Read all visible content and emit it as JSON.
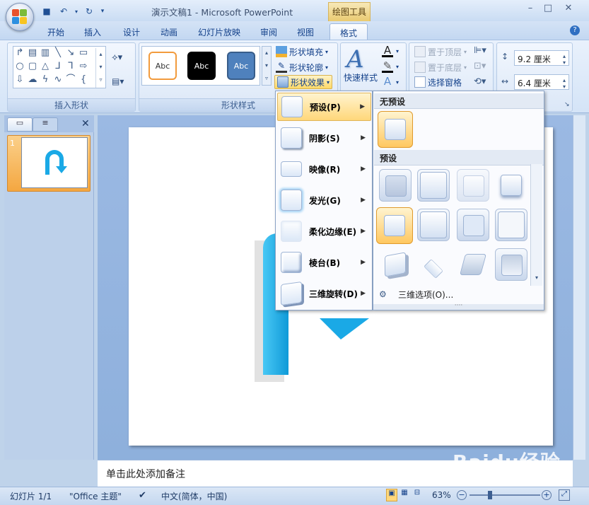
{
  "window": {
    "title": "演示文稿1 - Microsoft PowerPoint",
    "context_tab": "绘图工具"
  },
  "tabs": [
    {
      "label": "开始"
    },
    {
      "label": "插入"
    },
    {
      "label": "设计"
    },
    {
      "label": "动画"
    },
    {
      "label": "幻灯片放映"
    },
    {
      "label": "审阅"
    },
    {
      "label": "视图"
    },
    {
      "label": "格式"
    }
  ],
  "ribbon": {
    "insert_shapes_label": "插入形状",
    "shape_styles_label": "形状样式",
    "style_samples": [
      "Abc",
      "Abc",
      "Abc"
    ],
    "shape_fill": "形状填充",
    "shape_outline": "形状轮廓",
    "shape_effects": "形状效果",
    "quick_styles": "快速样式",
    "bring_to_front": "置于顶层",
    "send_to_back": "置于底层",
    "selection_pane": "选择窗格",
    "height_value": "9.2 厘米",
    "width_value": "6.4 厘米"
  },
  "effects_menu": {
    "items": [
      {
        "label": "预设(P)"
      },
      {
        "label": "阴影(S)"
      },
      {
        "label": "映像(R)"
      },
      {
        "label": "发光(G)"
      },
      {
        "label": "柔化边缘(E)"
      },
      {
        "label": "棱台(B)"
      },
      {
        "label": "三维旋转(D)"
      }
    ]
  },
  "presets_gallery": {
    "no_preset_header": "无预设",
    "preset_header": "预设",
    "options_label": "三维选项(O)..."
  },
  "slides_pane": {
    "slide_number": "1"
  },
  "notes": {
    "placeholder": "单击此处添加备注"
  },
  "status": {
    "slide_info": "幻灯片 1/1",
    "theme": "\"Office 主题\"",
    "language": "中文(简体，中国)",
    "zoom": "63%"
  },
  "watermark": "Baidu经验",
  "colors": {
    "accent_orange": "#f4a741",
    "shape_cyan": "#1aa9e6",
    "ribbon_blue": "#15428b"
  }
}
